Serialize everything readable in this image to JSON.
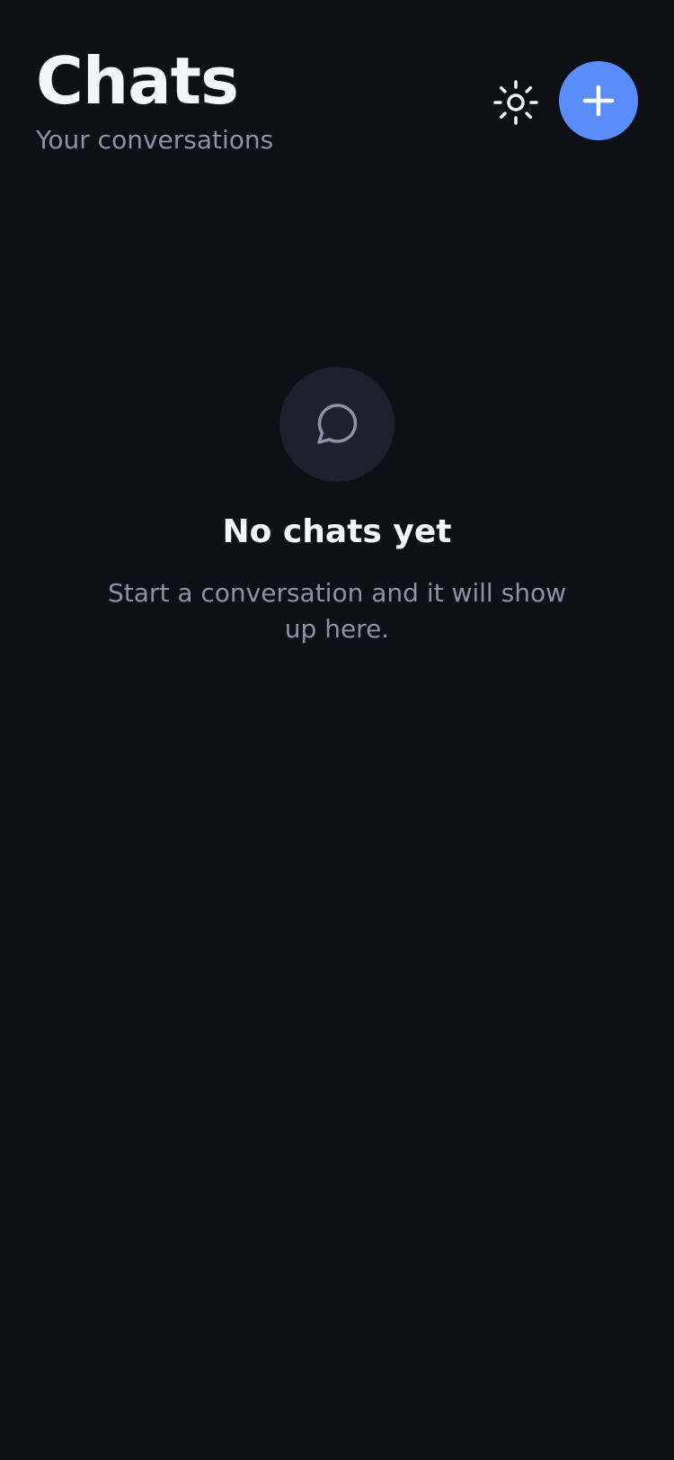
{
  "header": {
    "title": "Chats",
    "subtitle": "Your conversations",
    "theme_toggle_icon": "sun-icon",
    "new_chat_icon": "plus-icon"
  },
  "empty_state": {
    "icon": "chat-bubble-icon",
    "title": "No chats yet",
    "description": "Start a conversation and it will show up here."
  },
  "colors": {
    "background": "#0d1016",
    "primary_text": "#f3f5fa",
    "secondary_text": "#8d93a3",
    "accent": "#5b8dfa",
    "icon_circle": "#1c222d"
  }
}
